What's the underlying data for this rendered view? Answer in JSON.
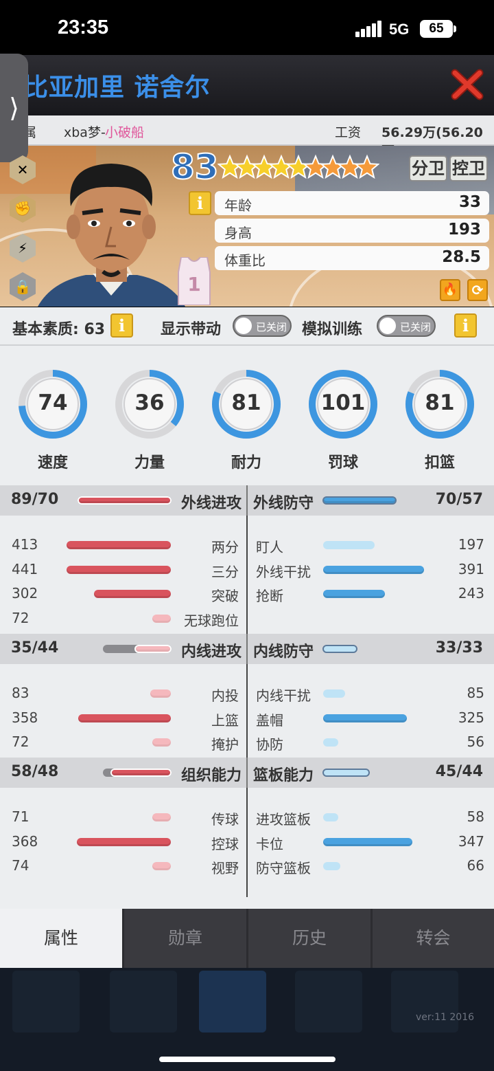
{
  "status_bar": {
    "time": "23:35",
    "network": "5G",
    "battery": "65"
  },
  "player": {
    "name": "比亚加里 诺舍尔",
    "overall": "83",
    "jersey": "1",
    "stars_gold": 5,
    "stars_total": 9
  },
  "info_row": {
    "team_label": "属",
    "team_prefix": "xba梦-",
    "team_name": "小破船",
    "salary_label": "工资",
    "salary_value": "56.29万(56.20万)"
  },
  "positions": [
    "分卫",
    "控卫"
  ],
  "bio": [
    {
      "label": "年龄",
      "value": "33"
    },
    {
      "label": "身高",
      "value": "193"
    },
    {
      "label": "体重比",
      "value": "28.5"
    }
  ],
  "quality_row": {
    "base_label": "基本素质: 63",
    "info_icon": "i",
    "drive_label": "显示带动",
    "drive_toggle": "已关闭",
    "train_label": "模拟训练",
    "train_toggle": "已关闭"
  },
  "dials": [
    {
      "label": "速度",
      "value": "74",
      "fraction": 0.74
    },
    {
      "label": "力量",
      "value": "36",
      "fraction": 0.36
    },
    {
      "label": "耐力",
      "value": "81",
      "fraction": 0.81
    },
    {
      "label": "罚球",
      "value": "101",
      "fraction": 1.0
    },
    {
      "label": "扣篮",
      "value": "81",
      "fraction": 0.81
    }
  ],
  "sections": [
    {
      "left": {
        "title": "外线进攻",
        "score": "89/70",
        "fraction": 0.89
      },
      "right": {
        "title": "外线防守",
        "score": "70/57",
        "fraction": 0.7
      },
      "rows_left": [
        {
          "label": "两分",
          "value": "413",
          "fraction": 0.62
        },
        {
          "label": "三分",
          "value": "441",
          "fraction": 0.66
        },
        {
          "label": "突破",
          "value": "302",
          "fraction": 0.45
        },
        {
          "label": "无球跑位",
          "value": "72",
          "fraction": 0.11
        }
      ],
      "rows_right": [
        {
          "label": "盯人",
          "value": "197",
          "fraction": 0.3
        },
        {
          "label": "外线干扰",
          "value": "391",
          "fraction": 0.59
        },
        {
          "label": "抢断",
          "value": "243",
          "fraction": 0.36
        }
      ]
    },
    {
      "left": {
        "title": "内线进攻",
        "score": "35/44",
        "fraction": 0.35
      },
      "right": {
        "title": "内线防守",
        "score": "33/33",
        "fraction": 0.33
      },
      "rows_left": [
        {
          "label": "内投",
          "value": "83",
          "fraction": 0.12
        },
        {
          "label": "上篮",
          "value": "358",
          "fraction": 0.54
        },
        {
          "label": "掩护",
          "value": "72",
          "fraction": 0.11
        }
      ],
      "rows_right": [
        {
          "label": "内线干扰",
          "value": "85",
          "fraction": 0.13
        },
        {
          "label": "盖帽",
          "value": "325",
          "fraction": 0.49
        },
        {
          "label": "协防",
          "value": "56",
          "fraction": 0.09
        }
      ]
    },
    {
      "left": {
        "title": "组织能力",
        "score": "58/48",
        "fraction": 0.58
      },
      "right": {
        "title": "篮板能力",
        "score": "45/44",
        "fraction": 0.45
      },
      "rows_left": [
        {
          "label": "传球",
          "value": "71",
          "fraction": 0.11
        },
        {
          "label": "控球",
          "value": "368",
          "fraction": 0.55
        },
        {
          "label": "视野",
          "value": "74",
          "fraction": 0.11
        }
      ],
      "rows_right": [
        {
          "label": "进攻篮板",
          "value": "58",
          "fraction": 0.09
        },
        {
          "label": "卡位",
          "value": "347",
          "fraction": 0.52
        },
        {
          "label": "防守篮板",
          "value": "66",
          "fraction": 0.1
        }
      ]
    }
  ],
  "tabs": [
    "属性",
    "勋章",
    "历史",
    "转会"
  ],
  "active_tab": 0,
  "footer": {
    "version": "ver:11  2016"
  },
  "colors": {
    "title_blue": "#3b8fe8",
    "attack_red": "#d9545e",
    "defense_blue": "#4aa2e0",
    "team_pink": "#e0559a"
  }
}
